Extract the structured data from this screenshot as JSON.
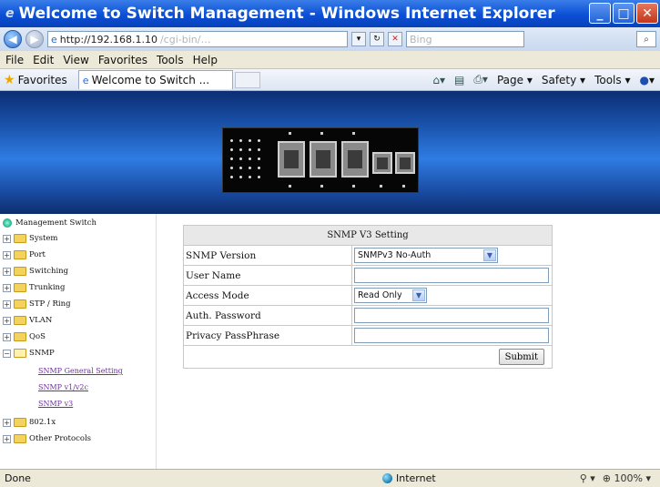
{
  "window": {
    "title": "Welcome to Switch Management - Windows Internet Explorer"
  },
  "address_bar": {
    "url_shown": "http://192.168.1.10",
    "url_faded": "/cgi-bin/…",
    "search_placeholder": "Bing"
  },
  "menu": [
    "File",
    "Edit",
    "View",
    "Favorites",
    "Tools",
    "Help"
  ],
  "command_bar": {
    "favorites_label": "Favorites",
    "tab_title": "Welcome to Switch ...",
    "page_label": "Page ▾",
    "safety_label": "Safety ▾",
    "tools_label": "Tools ▾",
    "help_label": "▾"
  },
  "sidebar": {
    "root": "Management Switch",
    "nodes": [
      "System",
      "Port",
      "Switching",
      "Trunking",
      "STP / Ring",
      "VLAN",
      "QoS",
      "SNMP",
      "802.1x",
      "Other Protocols"
    ],
    "snmp_children": [
      "SNMP General Setting",
      "SNMP v1/v2c",
      "SNMP v3"
    ]
  },
  "form": {
    "title": "SNMP V3 Setting",
    "rows": [
      {
        "label": "SNMP Version",
        "value": "SNMPv3 No-Auth"
      },
      {
        "label": "User Name",
        "value": ""
      },
      {
        "label": "Access Mode",
        "value": "Read Only"
      },
      {
        "label": "Auth. Password",
        "value": ""
      },
      {
        "label": "Privacy PassPhrase",
        "value": ""
      }
    ],
    "submit_label": "Submit"
  },
  "status_bar": {
    "status": "Done",
    "zone": "Internet",
    "zoom": "100%"
  }
}
